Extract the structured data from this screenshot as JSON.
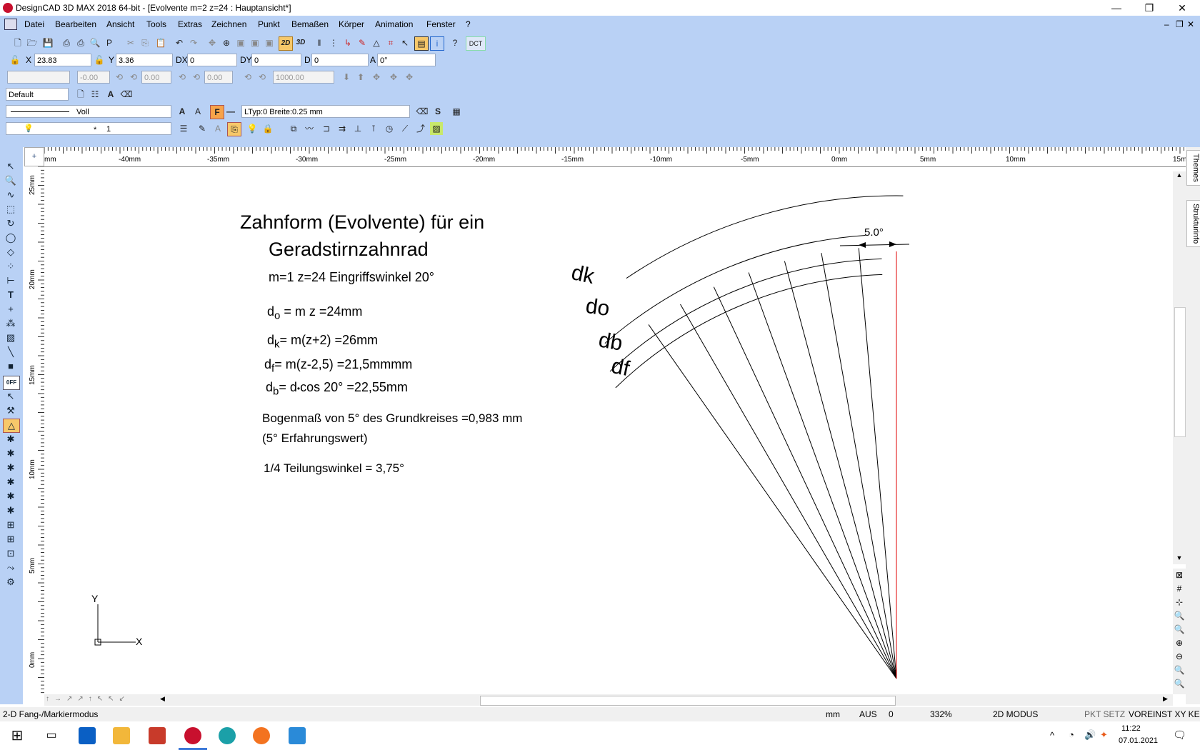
{
  "window": {
    "title": "DesignCAD 3D MAX 2018 64-bit - [Evolvente m=2  z=24 : Hauptansicht*]",
    "min_glyph": "—",
    "max_glyph": "❐",
    "close_glyph": "✕"
  },
  "menubar": [
    "Datei",
    "Bearbeiten",
    "Ansicht",
    "Tools",
    "Extras",
    "Zeichnen",
    "Punkt",
    "Bemaßen",
    "Körper",
    "Animation",
    "Fenster",
    "?"
  ],
  "mdi_controls": [
    "–",
    "❐",
    "✕"
  ],
  "coords": {
    "x_label": "X",
    "x_value": "23.83",
    "y_label": "Y",
    "y_value": "3.36",
    "dx_label": "DX",
    "dx_value": "0",
    "dy_label": "DY",
    "dy_value": "0",
    "d_label": "D",
    "d_value": "0",
    "a_label": "A",
    "a_value": "0°"
  },
  "row3": {
    "v1": "-0.00",
    "v2": "0.00",
    "v3": "0.00",
    "v4": "1000.00"
  },
  "layer_row": {
    "style": "Default"
  },
  "line_row": {
    "linename": "Voll",
    "ltype": "LTyp:0  Breite:0.25 mm",
    "dct": "DCT",
    "mode2d": "2D",
    "mode3d": "3D",
    "fbtn": "F"
  },
  "layer2_row": {
    "star": "*",
    "layer": "1"
  },
  "ruler": {
    "h_labels": [
      "mm",
      "-40mm",
      "-35mm",
      "-30mm",
      "-25mm",
      "-20mm",
      "-15mm",
      "-10mm",
      "-5mm",
      "0mm",
      "5mm",
      "10mm",
      "15m"
    ],
    "v_labels": [
      "25mm",
      "20mm",
      "15mm",
      "10mm",
      "5mm",
      "0mm"
    ]
  },
  "dock_tabs": [
    "Themes",
    "Strukturinfo"
  ],
  "drawing": {
    "title1": "Zahnform  (Evolvente)  für ein",
    "title2": "Geradstirnzahnrad",
    "params": "m=1  z=24   Eingriffswinkel 20°",
    "f1_a": "d",
    "f1_sub": "o",
    "f1_b": " = m z   =24mm",
    "f2_a": "d",
    "f2_sub": "k",
    "f2_b": "= m(z+2)   =26mm",
    "f3_a": "d",
    "f3_sub": "f",
    "f3_b": "= m(z-2,5)   =21,5mmmm",
    "f4_a": "d",
    "f4_sub": "b",
    "f4_b": "=  d",
    "f4_c": "•",
    "f4_d": "cos 20°    =22,55mm",
    "bogen": "Bogenmaß von 5° des Grundkreises  =0,983 mm",
    "erfahr": "(5° Erfahrungswert)",
    "teilung": "1/4 Teilungswinkel = 3,75°",
    "lbl_dk": "dk",
    "lbl_do": "do",
    "lbl_db": "db",
    "lbl_df": "df",
    "angle": "5.0°",
    "axis_y": "Y",
    "axis_x": "X"
  },
  "status": {
    "mode": "2-D Fang-/Markiermodus",
    "unit": "mm",
    "aus": "AUS",
    "zero": "0",
    "zoom": "332%",
    "mode2d": "2D MODUS",
    "pkt": "PKT SETZ",
    "voreinst": "VOREINST XY KE"
  },
  "taskbar": {
    "time": "11:22",
    "date": "07.01.2021"
  },
  "colors": {
    "chrome": "#b9d1f5",
    "red_line": "#e00000",
    "appicon": "#c8102e"
  }
}
